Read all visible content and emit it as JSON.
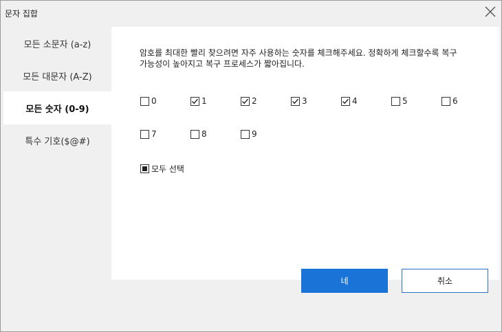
{
  "dialog": {
    "title": "문자 집합"
  },
  "sidebar": {
    "items": [
      {
        "label": "모든 소문자 (a-z)",
        "active": false
      },
      {
        "label": "모든 대문자 (A-Z)",
        "active": false
      },
      {
        "label": "모든 숫자 (0-9)",
        "active": true
      },
      {
        "label": "특수 기호($@#)",
        "active": false
      }
    ]
  },
  "main": {
    "description": "암호를 최대한 빨리 찾으려면 자주 사용하는 숫자를 체크해주세요. 정확하게 체크할수록 복구 가능성이 높아지고 복구 프로세스가 짧아집니다.",
    "digits": [
      {
        "label": "0",
        "checked": false
      },
      {
        "label": "1",
        "checked": true
      },
      {
        "label": "2",
        "checked": true
      },
      {
        "label": "3",
        "checked": true
      },
      {
        "label": "4",
        "checked": true
      },
      {
        "label": "5",
        "checked": false
      },
      {
        "label": "6",
        "checked": false
      },
      {
        "label": "7",
        "checked": false
      },
      {
        "label": "8",
        "checked": false
      },
      {
        "label": "9",
        "checked": false
      }
    ],
    "select_all": {
      "label": "모두 선택",
      "state": "partial"
    }
  },
  "footer": {
    "ok_label": "네",
    "cancel_label": "취소"
  },
  "colors": {
    "accent": "#1a73d6",
    "sidebar_bg": "#f0f0f0",
    "content_bg": "#ffffff"
  }
}
